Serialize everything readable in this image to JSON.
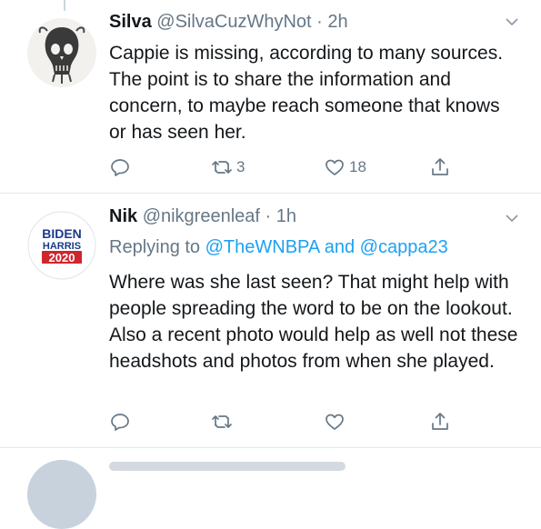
{
  "tweets": [
    {
      "name": "Silva",
      "handle": "@SilvaCuzWhyNot",
      "time": "2h",
      "avatar_icon": "skull-illustration-avatar",
      "text": "Cappie is missing, according to many sources. The point is to share the information and concern, to maybe reach someone that knows or has seen her.",
      "actions": {
        "reply_count": "",
        "retweet_count": "3",
        "like_count": "18"
      }
    },
    {
      "name": "Nik",
      "handle": "@nikgreenleaf",
      "time": "1h",
      "avatar_logo": {
        "line1": "BIDEN",
        "line2": "HARRIS",
        "line3": "2020"
      },
      "replying_prefix": "Replying to",
      "replying_mention_1": "@TheWNBPA",
      "replying_and": "and",
      "replying_mention_2": "@cappa23",
      "text": "Where was she last seen? That might help with people spreading the word to be on the lookout. Also a recent photo would help as well not these headshots and photos from when she played.",
      "actions": {
        "reply_count": "",
        "retweet_count": "",
        "like_count": ""
      }
    }
  ],
  "colors": {
    "accent": "#1da1f2",
    "secondary_text": "#657786",
    "divider": "#e1e8ed",
    "logo_blue": "#1b3a8c",
    "logo_red": "#d0252d"
  },
  "icons": [
    "reply-icon",
    "retweet-icon",
    "like-icon",
    "share-icon",
    "caret-down-icon"
  ]
}
